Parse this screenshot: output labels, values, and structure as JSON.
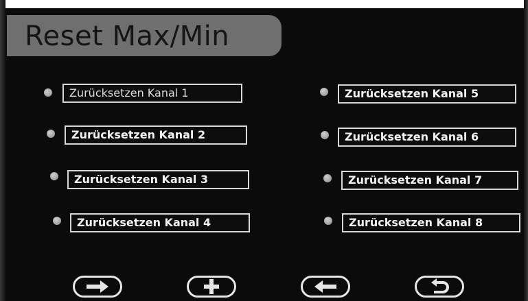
{
  "screen": {
    "title": "Reset Max/Min"
  },
  "channels": {
    "left": [
      {
        "label": "Zurücksetzen  Kanal 1"
      },
      {
        "label": "Zurücksetzen  Kanal 2"
      },
      {
        "label": "Zurücksetzen  Kanal 3"
      },
      {
        "label": "Zurücksetzen  Kanal 4"
      }
    ],
    "right": [
      {
        "label": "Zurücksetzen  Kanal 5"
      },
      {
        "label": "Zurücksetzen  Kanal 6"
      },
      {
        "label": "Zurücksetzen  Kanal 7"
      },
      {
        "label": "Zurücksetzen  Kanal 8"
      }
    ]
  },
  "navigation": {
    "buttons": [
      {
        "icon": "arrow-right-icon"
      },
      {
        "icon": "plus-icon"
      },
      {
        "icon": "arrow-left-icon"
      },
      {
        "icon": "return-icon"
      }
    ]
  },
  "colors": {
    "background": "#0b0b0b",
    "title_tab": "#6f6f6f",
    "button_border": "#d8d8d8",
    "radio_dot": "#a8a8a8"
  }
}
